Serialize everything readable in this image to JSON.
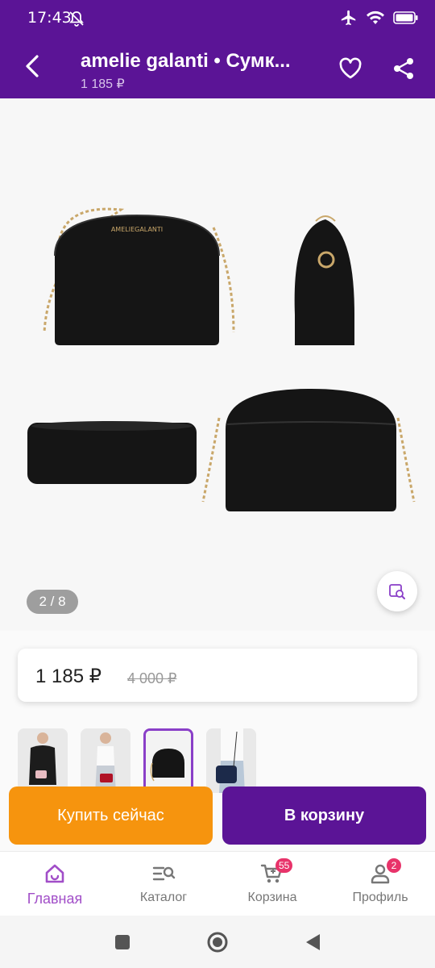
{
  "status_bar": {
    "time": "17:43"
  },
  "header": {
    "title": "amelie galanti • Сумк...",
    "price": "1 185 ₽"
  },
  "gallery": {
    "brand_label": "AMELIEGALANTI",
    "page_indicator": "2 / 8"
  },
  "price_card": {
    "current": "1 185 ₽",
    "old": "4 000 ₽"
  },
  "actions": {
    "buy_label": "Купить сейчас",
    "cart_label": "В корзину"
  },
  "bottom_nav": {
    "items": [
      {
        "label": "Главная",
        "icon": "home-icon",
        "badge": ""
      },
      {
        "label": "Каталог",
        "icon": "catalog-icon",
        "badge": ""
      },
      {
        "label": "Корзина",
        "icon": "cart-icon",
        "badge": "55"
      },
      {
        "label": "Профиль",
        "icon": "profile-icon",
        "badge": "2"
      }
    ]
  },
  "colors": {
    "brand_purple": "#5b1496",
    "accent_orange": "#f6940e",
    "active_nav": "#a14ec8",
    "badge": "#e8336a"
  }
}
